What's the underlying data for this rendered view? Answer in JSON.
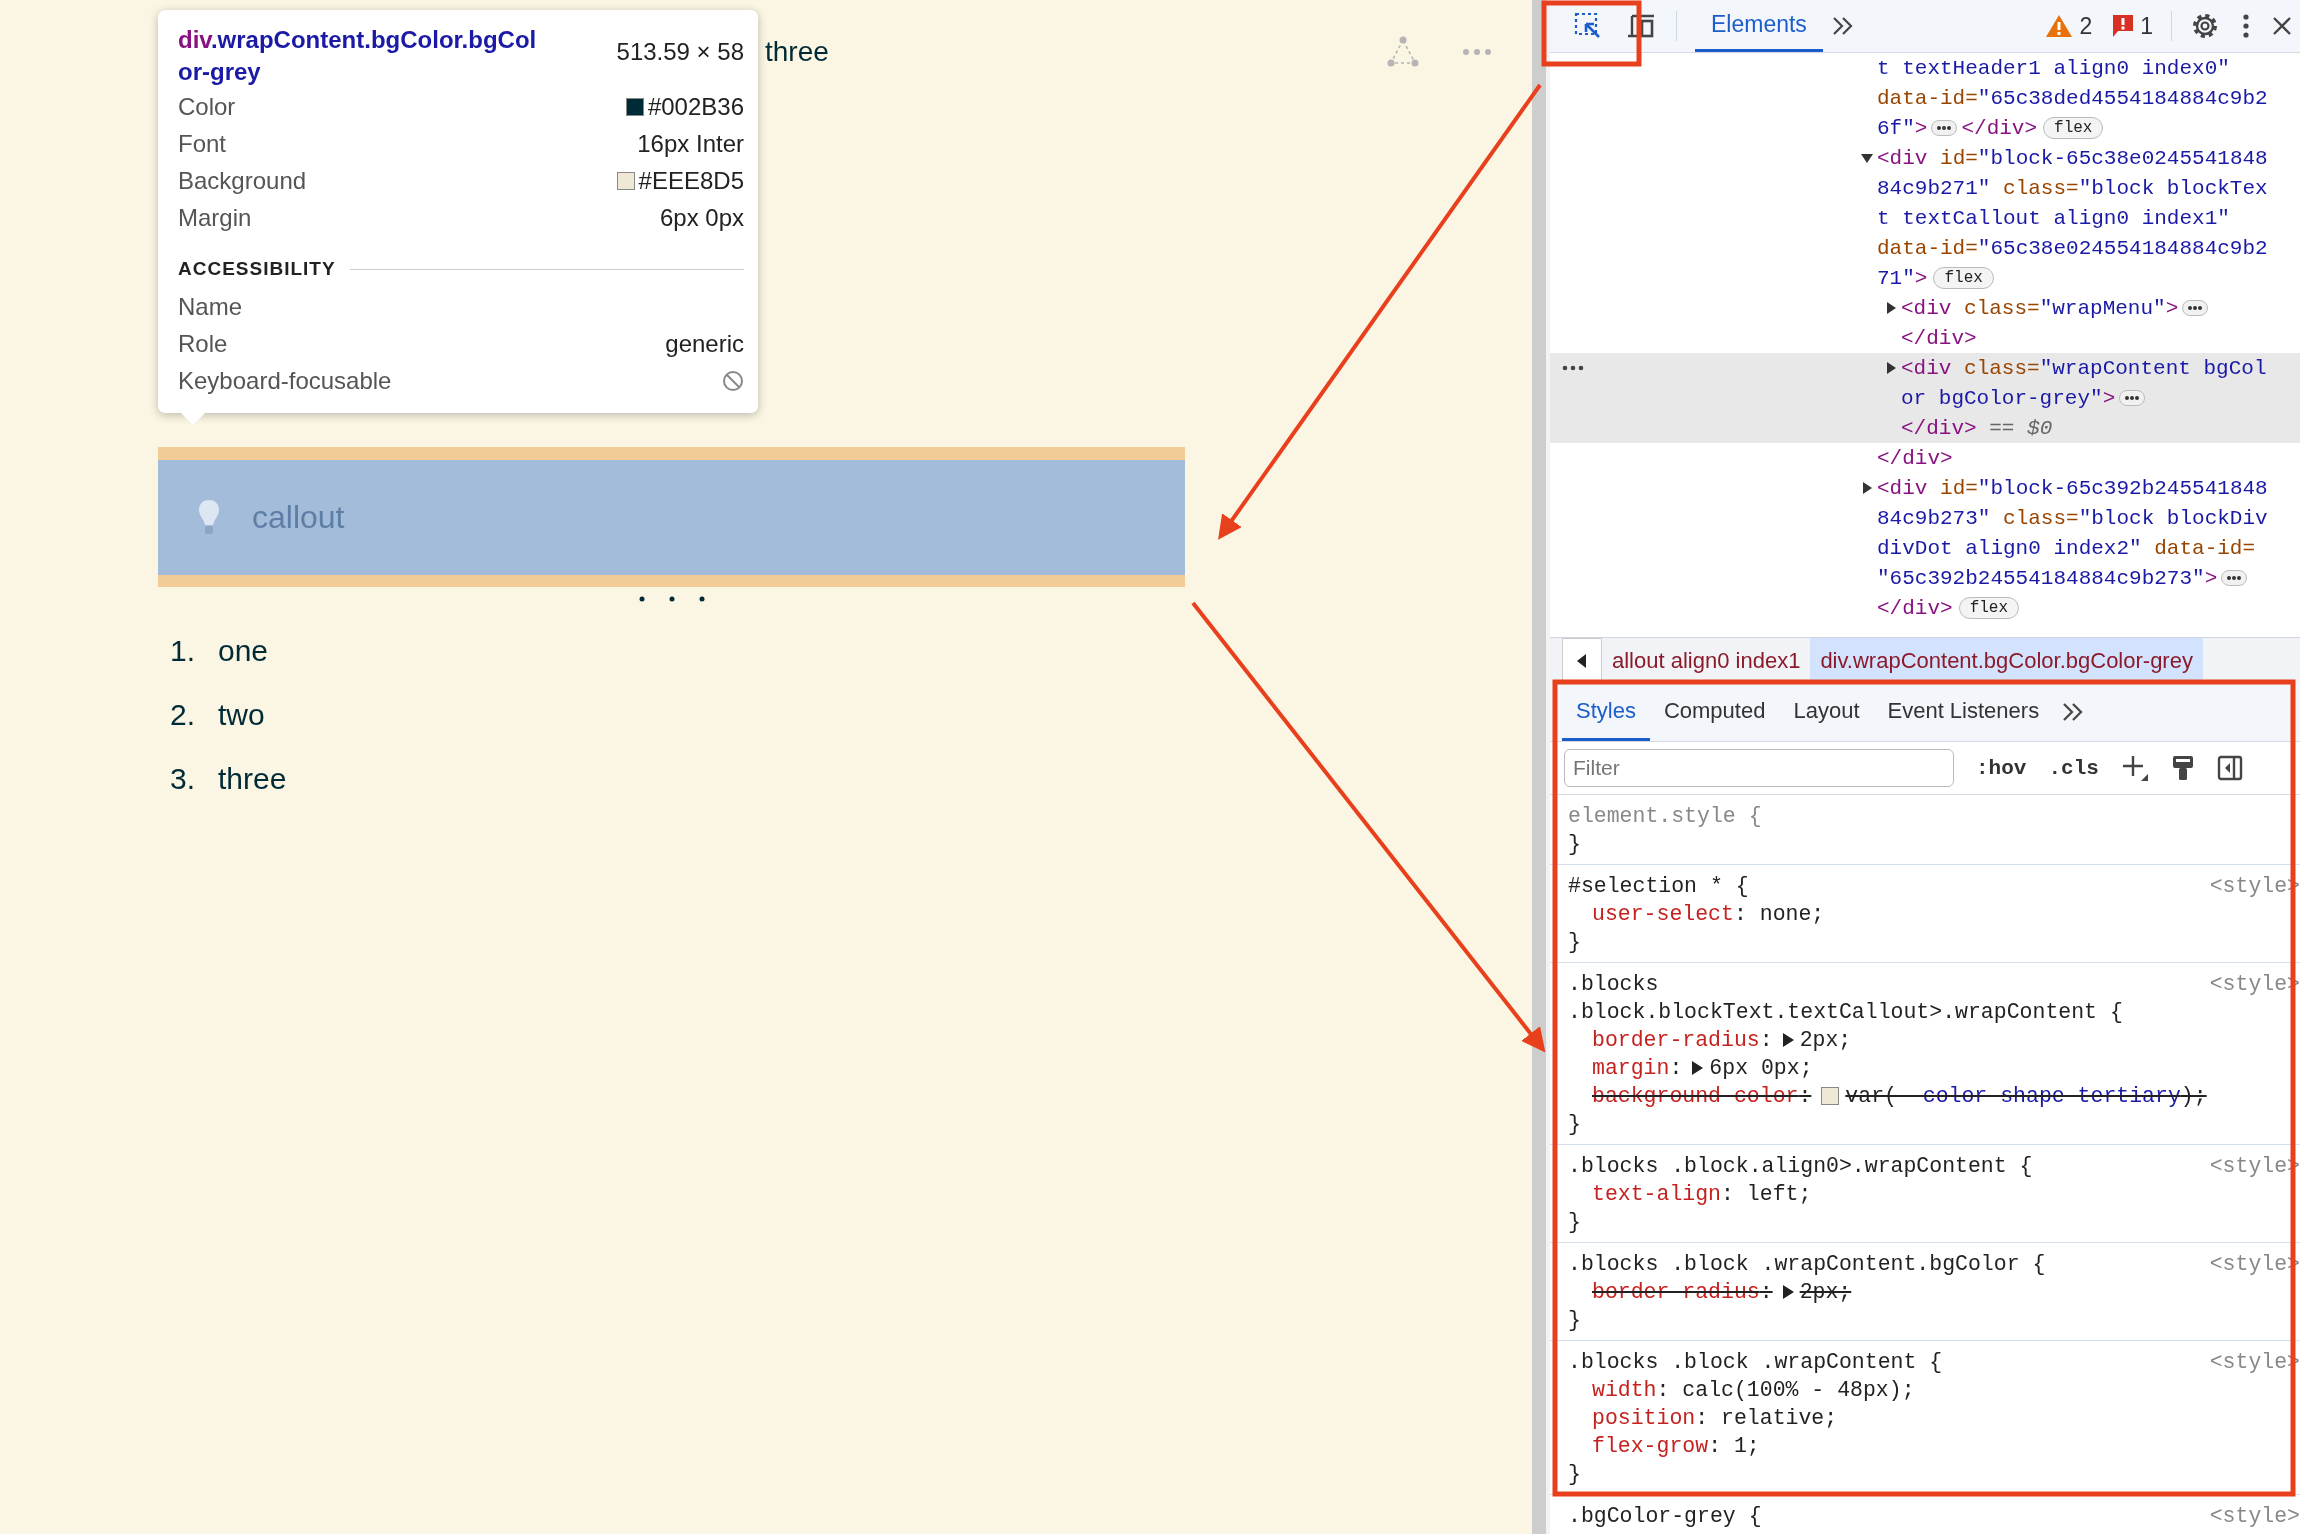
{
  "page": {
    "header": {
      "text": "three"
    },
    "callout": {
      "text": "callout"
    },
    "list": [
      {
        "marker": "1.",
        "text": "one"
      },
      {
        "marker": "2.",
        "text": "two"
      },
      {
        "marker": "3.",
        "text": "three"
      }
    ]
  },
  "tooltip": {
    "tag": "div",
    "classes": ".wrapContent.bgColor.bgColor-grey",
    "size": "513.59 × 58",
    "properties": [
      {
        "label": "Color",
        "value": "#002B36",
        "color": "#002b36"
      },
      {
        "label": "Font",
        "value": "16px Inter"
      },
      {
        "label": "Background",
        "value": "#EEE8D5",
        "color": "#eee8d5"
      },
      {
        "label": "Margin",
        "value": "6px 0px"
      }
    ],
    "accessibility_heading": "ACCESSIBILITY",
    "accessibility": [
      {
        "label": "Name"
      },
      {
        "label": "Role",
        "value": "generic"
      },
      {
        "label": "Keyboard-focusable",
        "focusable": false
      }
    ]
  },
  "devtools": {
    "inspect_active": true,
    "tabs": [
      {
        "label": "Elements",
        "selected": true
      }
    ],
    "warnings": "2",
    "errors": "1",
    "dom_tree": [
      {
        "selected": false,
        "lines": [
          [
            {
              "kind": "val",
              "text": "t textHeader1 align0 index0\""
            }
          ],
          [
            {
              "kind": "attr",
              "text": "data-id="
            },
            {
              "kind": "val",
              "text": "\"65c38ded4554184884c9b2"
            }
          ],
          [
            {
              "kind": "val",
              "text": "6f\""
            },
            {
              "kind": "tag",
              "text": ">"
            },
            {
              "kind": "ellipsis"
            },
            {
              "kind": "tag",
              "text": "</div>"
            },
            {
              "kind": "badge",
              "text": "flex"
            }
          ]
        ]
      },
      {
        "selected": false,
        "expanded": true,
        "lines": [
          [
            {
              "kind": "tag",
              "text": "<div"
            },
            {
              "kind": "attr",
              "text": " id="
            },
            {
              "kind": "val",
              "text": "\"block-65c38e0245541848"
            }
          ],
          [
            {
              "kind": "val",
              "text": "84c9b271\""
            },
            {
              "kind": "attr",
              "text": " class="
            },
            {
              "kind": "val",
              "text": "\"block blockTex"
            }
          ],
          [
            {
              "kind": "val",
              "text": "t textCallout align0 index1\""
            }
          ],
          [
            {
              "kind": "attr",
              "text": "data-id="
            },
            {
              "kind": "val",
              "text": "\"65c38e024554184884c9b2"
            }
          ],
          [
            {
              "kind": "val",
              "text": "71\""
            },
            {
              "kind": "tag",
              "text": ">"
            },
            {
              "kind": "badge",
              "text": "flex"
            }
          ]
        ],
        "children": [
          {
            "selected": false,
            "expanded": false,
            "lines": [
              [
                {
                  "kind": "tag",
                  "text": "<div"
                },
                {
                  "kind": "attr",
                  "text": " class="
                },
                {
                  "kind": "val",
                  "text": "\"wrapMenu\""
                },
                {
                  "kind": "tag",
                  "text": ">"
                },
                {
                  "kind": "ellipsis"
                }
              ],
              [
                {
                  "kind": "tag",
                  "text": "</div>"
                }
              ]
            ]
          },
          {
            "selected": true,
            "expanded": false,
            "lines": [
              [
                {
                  "kind": "tag",
                  "text": "<div"
                },
                {
                  "kind": "attr",
                  "text": " class="
                },
                {
                  "kind": "val",
                  "text": "\"wrapContent bgCol"
                }
              ],
              [
                {
                  "kind": "val",
                  "text": "or bgColor-grey\""
                },
                {
                  "kind": "tag",
                  "text": ">"
                },
                {
                  "kind": "ellipsis"
                }
              ],
              [
                {
                  "kind": "tag",
                  "text": "</div>"
                },
                {
                  "kind": "dim",
                  "text": " == $0"
                }
              ]
            ]
          }
        ],
        "close": [
          {
            "kind": "tag",
            "text": "</div>"
          }
        ]
      },
      {
        "selected": false,
        "expanded": false,
        "lines": [
          [
            {
              "kind": "tag",
              "text": "<div"
            },
            {
              "kind": "attr",
              "text": " id="
            },
            {
              "kind": "val",
              "text": "\"block-65c392b245541848"
            }
          ],
          [
            {
              "kind": "val",
              "text": "84c9b273\""
            },
            {
              "kind": "attr",
              "text": " class="
            },
            {
              "kind": "val",
              "text": "\"block blockDiv"
            }
          ],
          [
            {
              "kind": "val",
              "text": "divDot align0 index2\""
            },
            {
              "kind": "attr",
              "text": " data-id="
            }
          ],
          [
            {
              "kind": "val",
              "text": "\"65c392b24554184884c9b273\""
            },
            {
              "kind": "tag",
              "text": ">"
            },
            {
              "kind": "ellipsis"
            }
          ],
          [
            {
              "kind": "tag",
              "text": "</div>"
            },
            {
              "kind": "badge",
              "text": "flex"
            }
          ]
        ]
      }
    ],
    "breadcrumbs": [
      {
        "text": "allout align0 index1",
        "selected": false
      },
      {
        "text": "div.wrapContent.bgColor.bgColor-grey",
        "selected": true
      }
    ],
    "pane_tabs": [
      {
        "label": "Styles",
        "selected": true
      },
      {
        "label": "Computed",
        "selected": false
      },
      {
        "label": "Layout",
        "selected": false
      },
      {
        "label": "Event Listeners",
        "selected": false
      }
    ],
    "filter": {
      "placeholder": "Filter"
    },
    "filter_buttons": [
      ":hov",
      ".cls"
    ],
    "rules": [
      {
        "inline": true,
        "selector": [
          "element.style {"
        ],
        "close": "}"
      },
      {
        "inline": false,
        "selector": [
          "#selection * {"
        ],
        "source": "<style>",
        "declarations": [
          {
            "name": "user-select",
            "sep": ":",
            "value": " none;",
            "struck": false
          }
        ],
        "close": "}"
      },
      {
        "inline": false,
        "selector": [
          ".blocks",
          ".block.blockText.textCallout>.wrapContent {"
        ],
        "source": "<style>",
        "declarations": [
          {
            "name": "border-radius",
            "sep": ":",
            "expandable": true,
            "value": "2px;",
            "struck": false
          },
          {
            "name": "margin",
            "sep": ":",
            "expandable": true,
            "value": "6px 0px;",
            "struck": false
          },
          {
            "name": "background-color",
            "sep": ":",
            "color": "#eee8d5",
            "value": "var(",
            "var": "--color-shape-tertiary",
            "value_end": ");",
            "struck": true
          }
        ],
        "close": "}"
      },
      {
        "inline": false,
        "selector": [
          ".blocks .block.align0>.wrapContent {"
        ],
        "source": "<style>",
        "declarations": [
          {
            "name": "text-align",
            "sep": ":",
            "value": " left;",
            "struck": false
          }
        ],
        "close": "}"
      },
      {
        "inline": false,
        "selector": [
          ".blocks .block .wrapContent.bgColor {"
        ],
        "source": "<style>",
        "declarations": [
          {
            "name": "border-radius",
            "sep": ":",
            "expandable": true,
            "value": "2px;",
            "struck": true
          }
        ],
        "close": "}"
      },
      {
        "inline": false,
        "selector": [
          ".blocks .block .wrapContent {"
        ],
        "source": "<style>",
        "declarations": [
          {
            "name": "width",
            "sep": ":",
            "value": " calc(100% - 48px);",
            "struck": false
          },
          {
            "name": "position",
            "sep": ":",
            "value": " relative;",
            "struck": false
          },
          {
            "name": "flex-grow",
            "sep": ":",
            "value": " 1;",
            "struck": false
          }
        ],
        "close": "}"
      },
      {
        "inline": false,
        "selector": [
          ".bgColor-grey {"
        ],
        "source": "<style>"
      }
    ]
  }
}
